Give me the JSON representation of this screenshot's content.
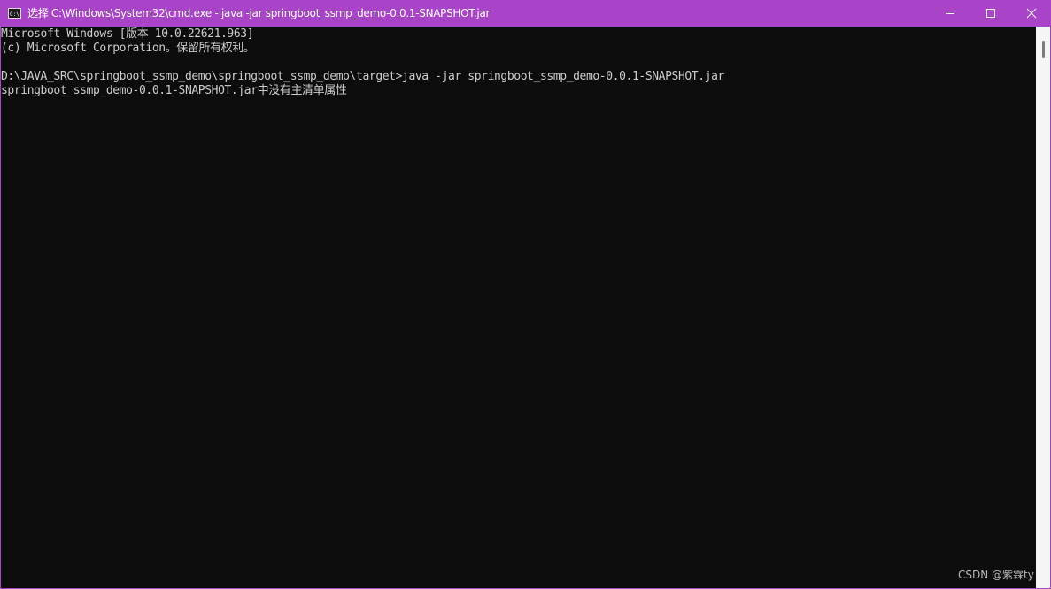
{
  "window": {
    "title": "选择 C:\\Windows\\System32\\cmd.exe - java  -jar springboot_ssmp_demo-0.0.1-SNAPSHOT.jar",
    "accent_color": "#a944c8",
    "icons": {
      "app": "cmd-app-icon",
      "minimize": "minimize-icon",
      "maximize": "maximize-icon",
      "close": "close-icon"
    }
  },
  "console": {
    "background": "#0c0c0c",
    "text_color": "#cccccc",
    "lines": [
      "Microsoft Windows [版本 10.0.22621.963]",
      "(c) Microsoft Corporation。保留所有权利。",
      "",
      "D:\\JAVA_SRC\\springboot_ssmp_demo\\springboot_ssmp_demo\\target>java -jar springboot_ssmp_demo-0.0.1-SNAPSHOT.jar",
      "springboot_ssmp_demo-0.0.1-SNAPSHOT.jar中没有主清单属性"
    ]
  },
  "watermark": "CSDN @紫霖ty"
}
